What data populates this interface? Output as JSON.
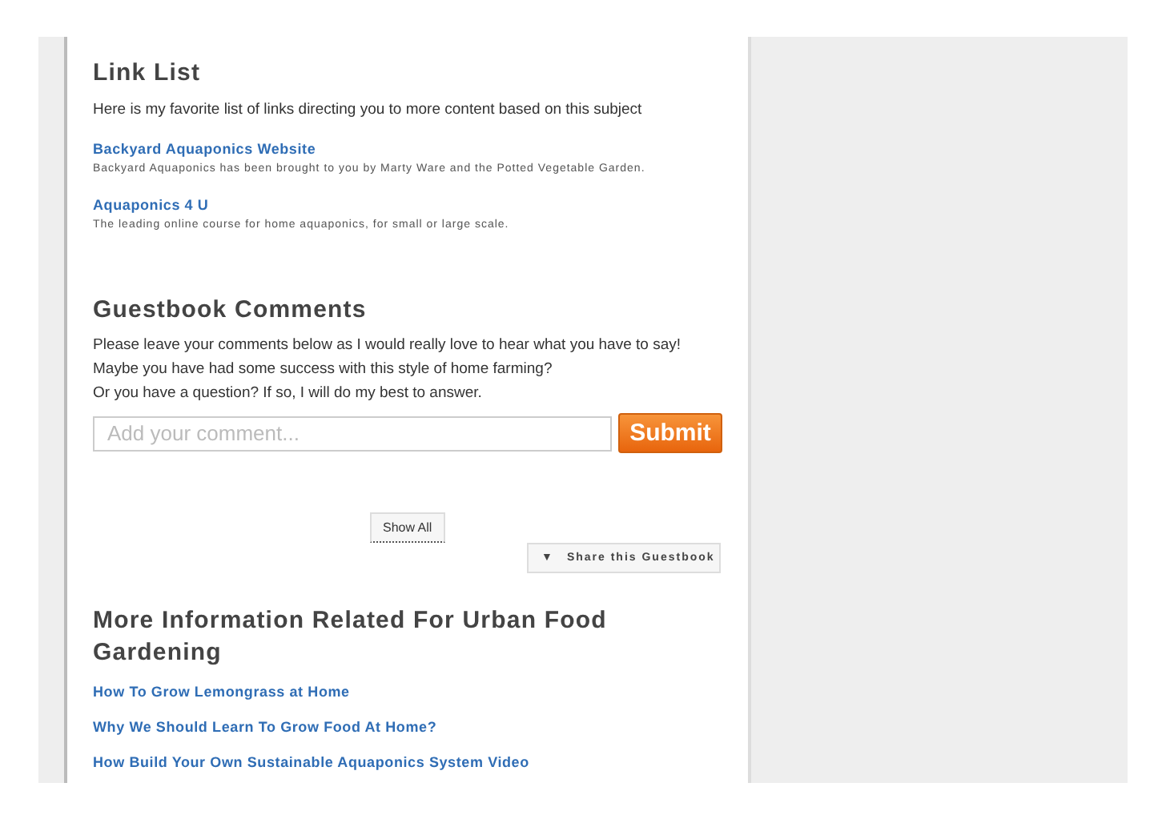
{
  "link_list": {
    "title": "Link List",
    "intro": "Here is my favorite list of links directing you to more content based on this subject",
    "links": [
      {
        "title": "Backyard Aquaponics Website",
        "description": "Backyard Aquaponics has been brought to you by Marty Ware and the Potted Vegetable Garden."
      },
      {
        "title": "Aquaponics 4 U",
        "description": "The leading online course for home aquaponics, for small or large scale."
      }
    ]
  },
  "guestbook": {
    "title": "Guestbook Comments",
    "lines": [
      "Please leave your comments below as I would really love to hear what you have to say!",
      "Maybe you have had some success with this style of home farming?",
      "Or you have a question? If so, I will do my best to answer."
    ],
    "comment_field": {
      "placeholder": "Add your comment..."
    },
    "submit_button": "Submit",
    "show_all_button": "Show All",
    "share_button": {
      "icon": "▼",
      "label": "Share this Guestbook"
    }
  },
  "more_info": {
    "title": "More Information Related For Urban Food Gardening",
    "links": [
      "How To Grow Lemongrass at Home",
      "Why We Should Learn To Grow Food At Home?",
      "How Build Your Own Sustainable Aquaponics System Video"
    ]
  }
}
